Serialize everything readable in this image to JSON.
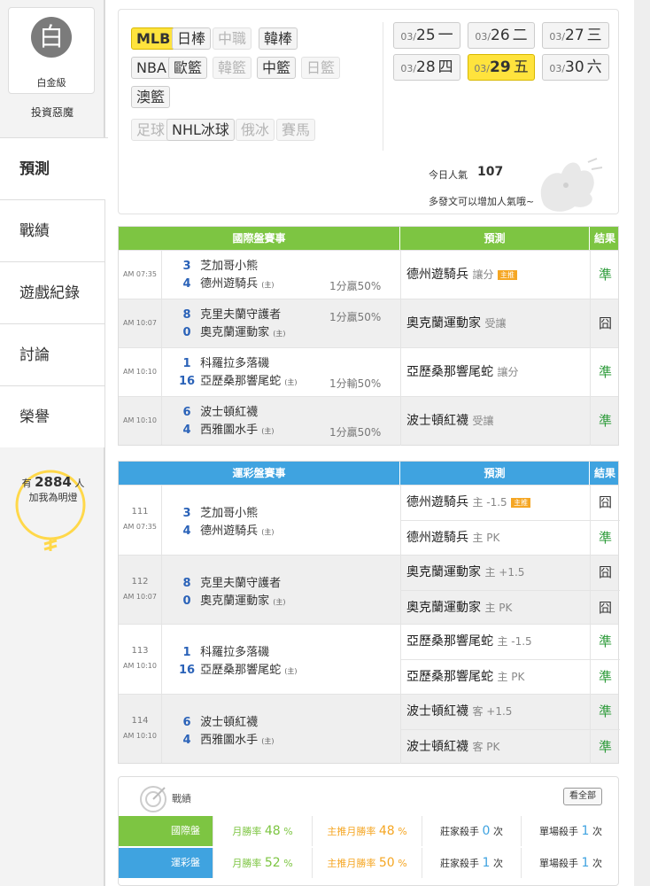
{
  "profile": {
    "avatar_char": "白",
    "level": "白金級",
    "username": "投資惡魔"
  },
  "nav": [
    "預測",
    "戰績",
    "遊戲紀錄",
    "討論",
    "榮譽"
  ],
  "fans": {
    "prefix": "有",
    "count": "2884",
    "suffix": "人",
    "line2": "加我為明燈"
  },
  "sports": {
    "row1": [
      {
        "label": "MLB",
        "state": "selected"
      },
      {
        "label": "日棒",
        "state": "on"
      },
      {
        "label": "中職",
        "state": "off"
      },
      {
        "label": "韓棒",
        "state": "on"
      }
    ],
    "row2": [
      {
        "label": "NBA",
        "state": "on"
      },
      {
        "label": "歐籃",
        "state": "on"
      },
      {
        "label": "韓籃",
        "state": "off"
      },
      {
        "label": "中籃",
        "state": "on"
      },
      {
        "label": "日籃",
        "state": "off"
      }
    ],
    "row3": [
      {
        "label": "澳籃",
        "state": "on"
      }
    ],
    "row4": [
      {
        "label": "足球",
        "state": "off"
      },
      {
        "label": "NHL冰球",
        "state": "on"
      },
      {
        "label": "俄冰",
        "state": "off"
      },
      {
        "label": "賽馬",
        "state": "off"
      }
    ]
  },
  "dates": [
    {
      "md": "03/",
      "d": "25",
      "wd": "一",
      "selected": false
    },
    {
      "md": "03/",
      "d": "26",
      "wd": "二",
      "selected": false
    },
    {
      "md": "03/",
      "d": "27",
      "wd": "三",
      "selected": false
    },
    {
      "md": "03/",
      "d": "28",
      "wd": "四",
      "selected": false
    },
    {
      "md": "03/",
      "d": "29",
      "wd": "五",
      "selected": true
    },
    {
      "md": "03/",
      "d": "30",
      "wd": "六",
      "selected": false
    }
  ],
  "popularity": {
    "label": "今日人氣",
    "value": "107",
    "tip": "多發文可以增加人氣哦~"
  },
  "intl_table": {
    "headers": [
      "國際盤賽事",
      "預測",
      "結果"
    ],
    "home_mark": "(主)",
    "rows": [
      {
        "time": "AM 07:35",
        "away": "芝加哥小熊",
        "away_score": "3",
        "home": "德州遊騎兵",
        "home_score": "4",
        "odds": "1分贏50%",
        "odds_pos": "home",
        "pick": "德州遊騎兵",
        "tag": "讓分",
        "badge": "主推",
        "result": "準"
      },
      {
        "time": "AM 10:07",
        "away": "克里夫蘭守護者",
        "away_score": "8",
        "home": "奧克蘭運動家",
        "home_score": "0",
        "odds": "1分贏50%",
        "odds_pos": "away",
        "pick": "奧克蘭運動家",
        "tag": "受讓",
        "badge": "",
        "result": "囧"
      },
      {
        "time": "AM 10:10",
        "away": "科羅拉多落磯",
        "away_score": "1",
        "home": "亞歷桑那響尾蛇",
        "home_score": "16",
        "odds": "1分輸50%",
        "odds_pos": "home",
        "pick": "亞歷桑那響尾蛇",
        "tag": "讓分",
        "badge": "",
        "result": "準"
      },
      {
        "time": "AM 10:10",
        "away": "波士頓紅襪",
        "away_score": "6",
        "home": "西雅圖水手",
        "home_score": "4",
        "odds": "1分贏50%",
        "odds_pos": "home",
        "pick": "波士頓紅襪",
        "tag": "受讓",
        "badge": "",
        "result": "準"
      }
    ]
  },
  "lottery_table": {
    "headers": [
      "運彩盤賽事",
      "預測",
      "結果"
    ],
    "home_mark": "(主)",
    "games": [
      {
        "no": "111",
        "time": "AM 07:35",
        "away": "芝加哥小熊",
        "away_score": "3",
        "home": "德州遊騎兵",
        "home_score": "4",
        "picks": [
          {
            "team": "德州遊騎兵",
            "tag": "主 -1.5",
            "badge": "主推",
            "result": "囧"
          },
          {
            "team": "德州遊騎兵",
            "tag": "主 PK",
            "badge": "",
            "result": "準"
          }
        ]
      },
      {
        "no": "112",
        "time": "AM 10:07",
        "away": "克里夫蘭守護者",
        "away_score": "8",
        "home": "奧克蘭運動家",
        "home_score": "0",
        "picks": [
          {
            "team": "奧克蘭運動家",
            "tag": "主 +1.5",
            "badge": "",
            "result": "囧"
          },
          {
            "team": "奧克蘭運動家",
            "tag": "主 PK",
            "badge": "",
            "result": "囧"
          }
        ]
      },
      {
        "no": "113",
        "time": "AM 10:10",
        "away": "科羅拉多落磯",
        "away_score": "1",
        "home": "亞歷桑那響尾蛇",
        "home_score": "16",
        "picks": [
          {
            "team": "亞歷桑那響尾蛇",
            "tag": "主 -1.5",
            "badge": "",
            "result": "準"
          },
          {
            "team": "亞歷桑那響尾蛇",
            "tag": "主 PK",
            "badge": "",
            "result": "準"
          }
        ]
      },
      {
        "no": "114",
        "time": "AM 10:10",
        "away": "波士頓紅襪",
        "away_score": "6",
        "home": "西雅圖水手",
        "home_score": "4",
        "picks": [
          {
            "team": "波士頓紅襪",
            "tag": "客 +1.5",
            "badge": "",
            "result": "準"
          },
          {
            "team": "波士頓紅襪",
            "tag": "客 PK",
            "badge": "",
            "result": "準"
          }
        ]
      }
    ]
  },
  "record": {
    "title": "戰績",
    "view_all": "看全部",
    "rows": [
      {
        "label": "國際盤",
        "rate_label": "月勝率",
        "rate": "48",
        "rate_unit": "%",
        "main_label": "主推月勝率",
        "main_rate": "48",
        "main_unit": "%",
        "house_label": "莊家殺手",
        "house": "0",
        "house_unit": "次",
        "single_label": "單場殺手",
        "single": "1",
        "single_unit": "次"
      },
      {
        "label": "運彩盤",
        "rate_label": "月勝率",
        "rate": "52",
        "rate_unit": "%",
        "main_label": "主推月勝率",
        "main_rate": "50",
        "main_unit": "%",
        "house_label": "莊家殺手",
        "house": "1",
        "house_unit": "次",
        "single_label": "單場殺手",
        "single": "1",
        "single_unit": "次"
      }
    ]
  },
  "colors": {
    "green": "#7dc542",
    "blue": "#3fa3e0",
    "yellow": "#ffe33d",
    "win": "#2d9b3a",
    "score": "#2a62b8",
    "orange": "#f5a623"
  }
}
